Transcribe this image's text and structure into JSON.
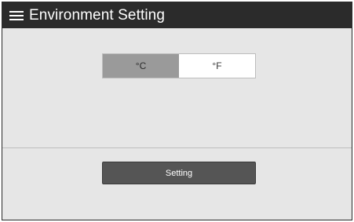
{
  "header": {
    "title": "Environment Setting",
    "menu_icon": "hamburger-menu-icon",
    "background": "#2b2b2b"
  },
  "temperature_unit": {
    "options": [
      "°C",
      "°F"
    ],
    "selected": "°C",
    "selected_color": "#9a9a9a"
  },
  "actions": {
    "setting_label": "Setting",
    "button_color": "#555555"
  }
}
